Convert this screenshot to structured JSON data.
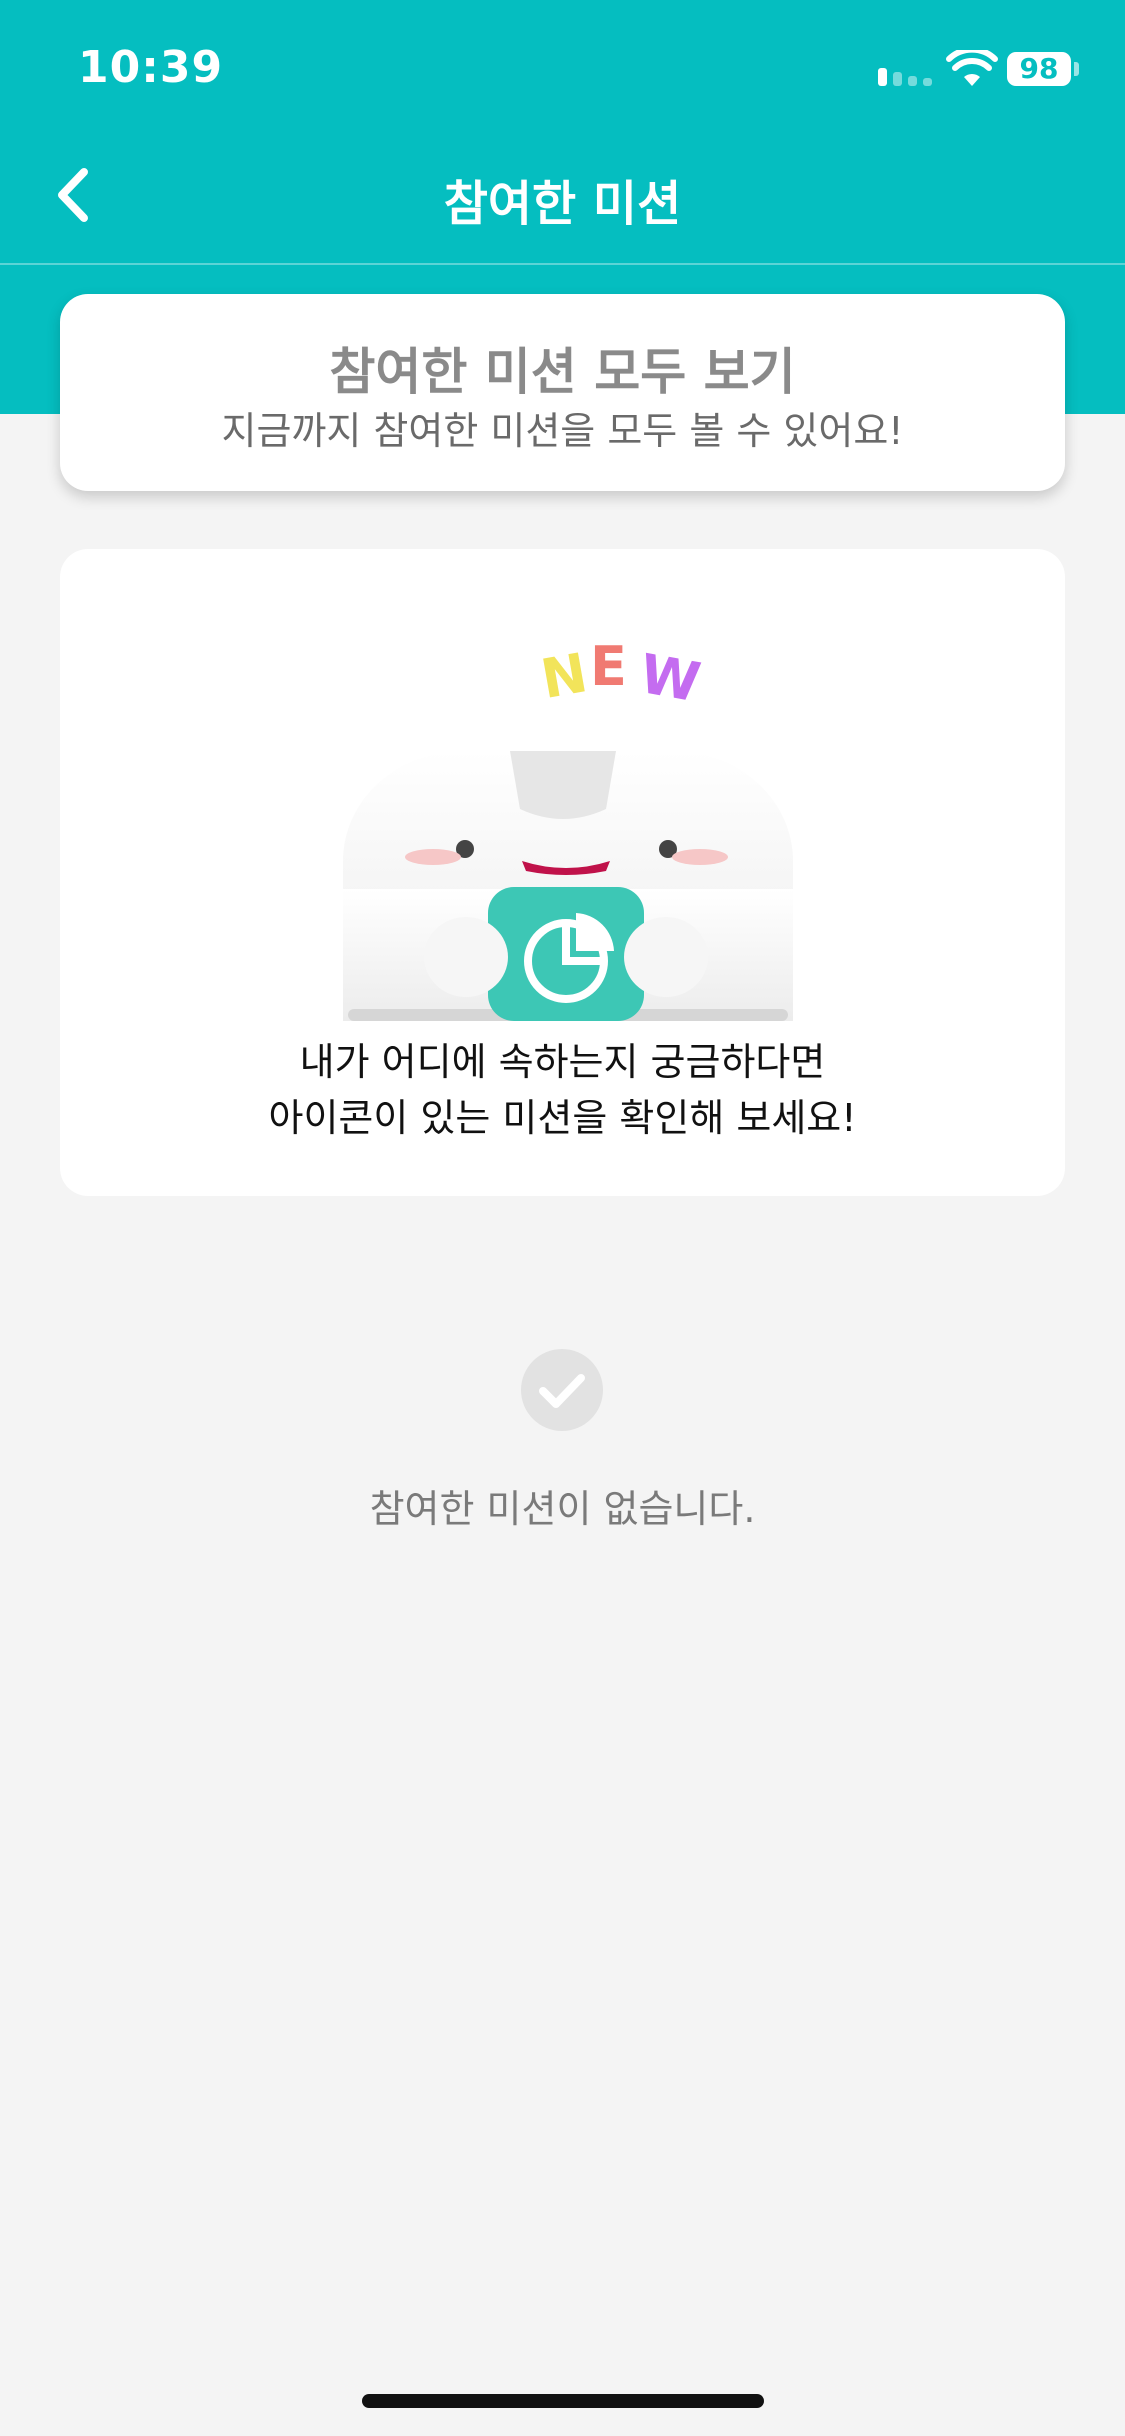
{
  "status_bar": {
    "time": "10:39",
    "battery": "98"
  },
  "header": {
    "title": "참여한 미션"
  },
  "view_all_card": {
    "title": "참여한 미션 모두 보기",
    "subtitle": "지금까지 참여한 미션을 모두 볼 수 있어요!"
  },
  "info_card": {
    "badge": "NEW",
    "line1": "내가 어디에 속하는지 궁금하다면",
    "line2": "아이콘이 있는 미션을 확인해 보세요!"
  },
  "empty_state": {
    "message": "참여한 미션이 없습니다."
  },
  "colors": {
    "accent": "#05bec0",
    "background": "#f4f4f4"
  }
}
